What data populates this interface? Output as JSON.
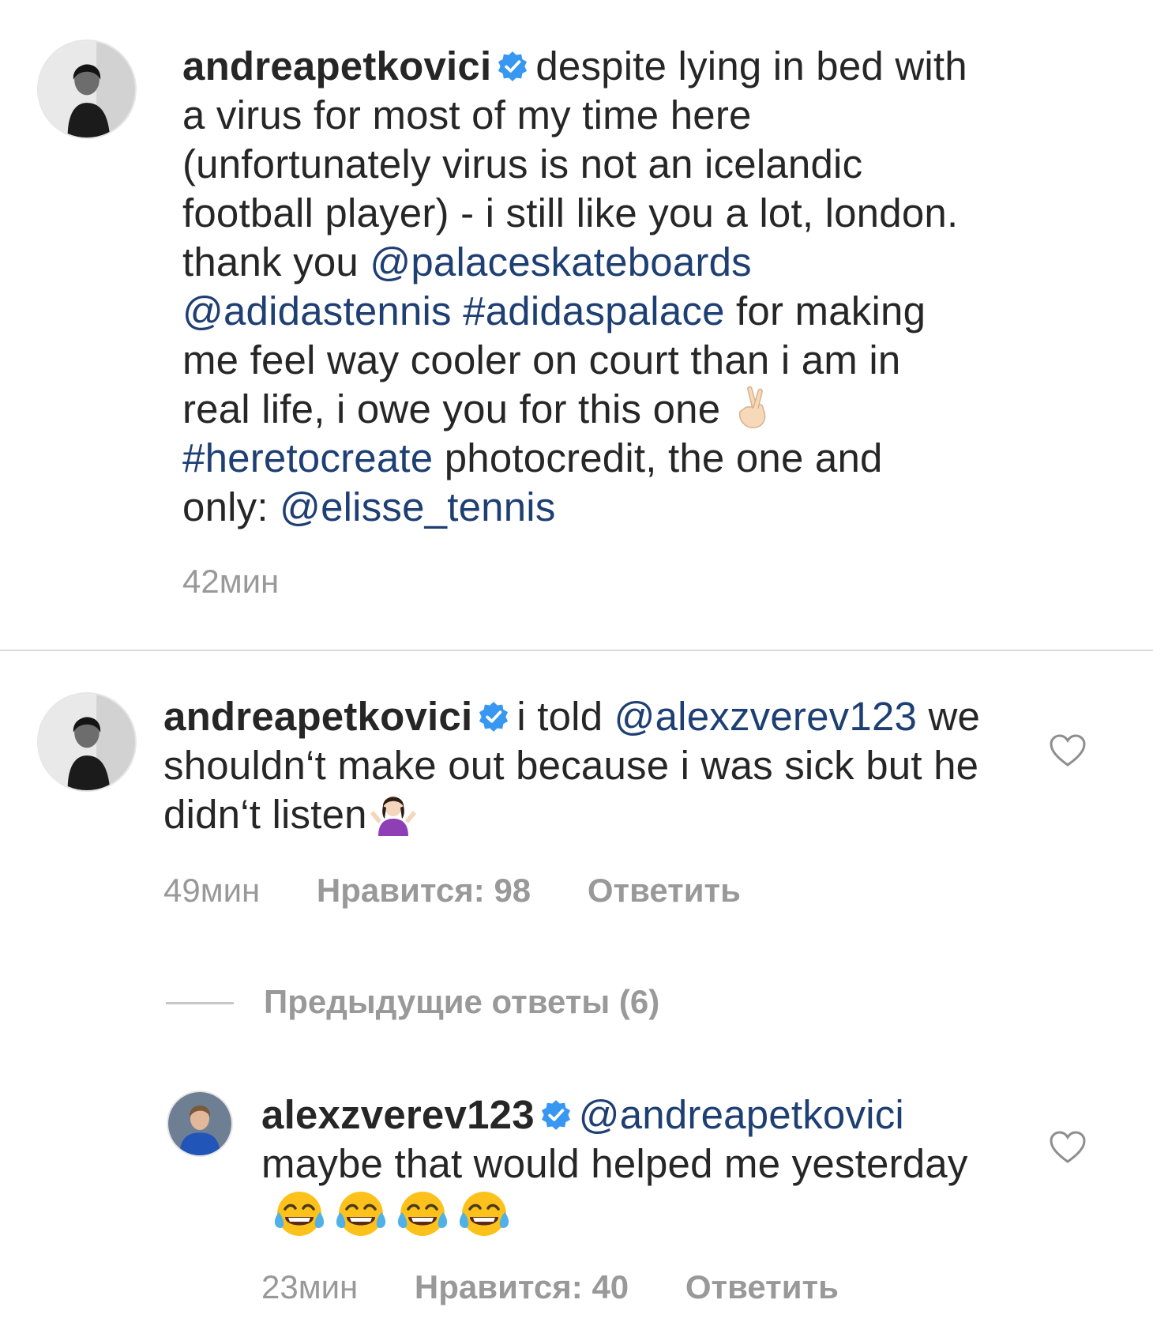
{
  "caption": {
    "username": "andreapetkovici",
    "text_1": "despite lying in bed with a virus for most of my time here (unfortunately virus is not an icelandic football player) - i still like you a lot, london. thank you",
    "mention_1": "@palaceskateboards",
    "mention_2": "@adidastennis",
    "hashtag_1": "#adidaspalace",
    "text_2": "for making me feel way cooler on court than i am in real life, i owe you for this one",
    "emoji_1": "crossed-fingers",
    "hashtag_2": "#heretocreate",
    "text_3": "photocredit, the one and only:",
    "mention_3": "@elisse_tennis",
    "time": "42мин"
  },
  "comments": [
    {
      "username": "andreapetkovici",
      "text_1": "i told",
      "mention": "@alexzverev123",
      "text_2": "we shouldn‘t make out because i was sick but he didn‘t listen",
      "emoji": "person-shrugging",
      "time": "49мин",
      "likes": "Нравится: 98",
      "reply": "Ответить"
    },
    {
      "username": "alexzverev123",
      "mention": "@andreapetkovici",
      "text": "maybe that would helped me yesterday",
      "emoji": "face-with-tears-of-joy x4",
      "time": "23мин",
      "likes": "Нравится: 40",
      "reply": "Ответить"
    }
  ],
  "previous_replies": "Предыдущие ответы (6)",
  "colors": {
    "text": "#262626",
    "link": "#1e3f73",
    "meta": "#999999",
    "verified": "#3897f0",
    "divider": "#dbdbdb"
  }
}
